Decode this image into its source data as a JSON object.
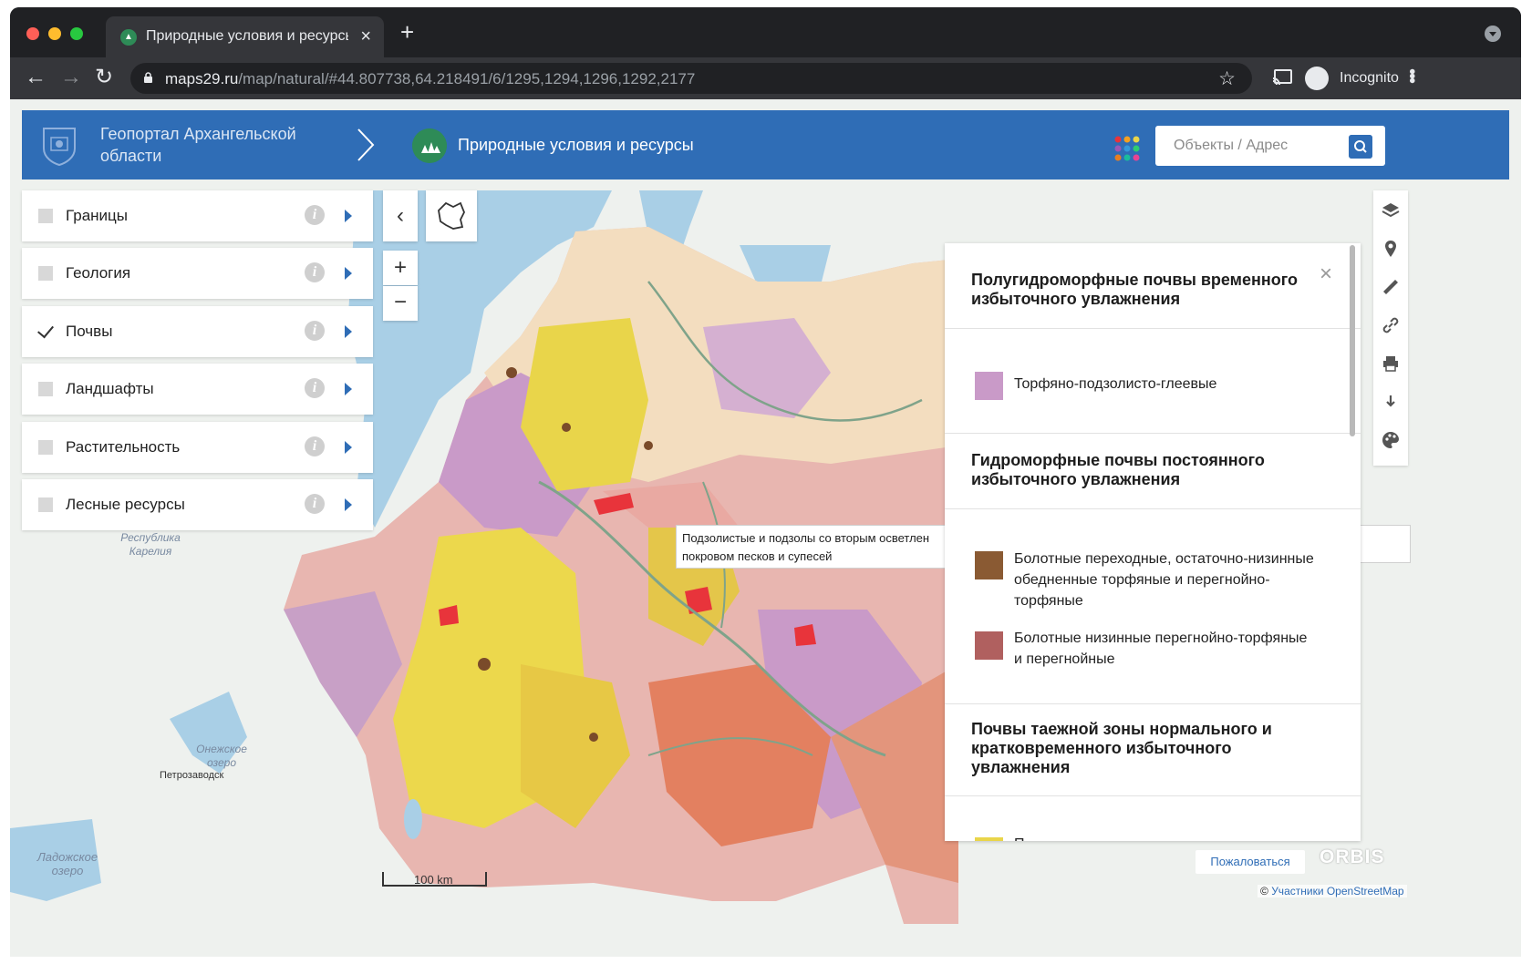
{
  "browser": {
    "tab_title": "Природные условия и ресурсы",
    "tab_close": "×",
    "new_tab": "+",
    "url_host": "maps29.ru",
    "url_path": "/map/natural/#44.807738,64.218491/6/1295,1294,1296,1292,2177",
    "incognito_label": "Incognito"
  },
  "header": {
    "portal_title": "Геопортал Архангельской области",
    "section_title": "Природные условия и ресурсы",
    "search_placeholder": "Объекты / Адрес"
  },
  "layers": [
    {
      "label": "Границы",
      "checked": false
    },
    {
      "label": "Геология",
      "checked": false
    },
    {
      "label": "Почвы",
      "checked": true
    },
    {
      "label": "Ландшафты",
      "checked": false
    },
    {
      "label": "Растительность",
      "checked": false
    },
    {
      "label": "Лесные ресурсы",
      "checked": false
    }
  ],
  "controls": {
    "collapse": "‹",
    "zoom_in": "+",
    "zoom_out": "−"
  },
  "tooltip": {
    "line1": "Подзолистые и подзолы со вторым осветлен",
    "line2": "покровом песков и супесей"
  },
  "legend": {
    "close": "×",
    "sections": [
      {
        "title": "Полугидроморфные почвы временного избыточного увлажнения",
        "items": [
          {
            "label": "Торфяно-подзолисто-глеевые",
            "color": "#c99ac8"
          }
        ]
      },
      {
        "title": "Гидроморфные почвы постоянного избыточного увлажнения",
        "items": [
          {
            "label": "Болотные переходные, остаточно-низинные обедненные торфяные и перегнойно-торфяные",
            "color": "#8a5a33"
          },
          {
            "label": "Болотные низинные перегнойно-торфяные и перегнойные",
            "color": "#b0605f"
          }
        ]
      },
      {
        "title": "Почвы таежной зоны нормального и кратковременного избыточного увлажнения",
        "items": []
      }
    ],
    "partial_next_label": "П"
  },
  "map": {
    "labels": {
      "karelia": "Республика Карелия",
      "onega": "Онежское озеро",
      "petrozavodsk": "Петрозаводск",
      "ladoga": "Ладожское озеро"
    },
    "scale": "100 km",
    "report_button": "Пожаловаться",
    "logo": "ORBIS",
    "attribution_prefix": "©",
    "attribution_link": "Участники OpenStreetMap"
  },
  "colors": {
    "header_blue": "#2f6db6",
    "accent_green": "#2e8b57",
    "water": "#a9cfe6",
    "soil_yellow": "#e9d54a",
    "soil_pink": "#e0a3a8",
    "soil_purple": "#c99ac8",
    "soil_cream": "#f5e5c6",
    "soil_orange": "#e38060"
  }
}
